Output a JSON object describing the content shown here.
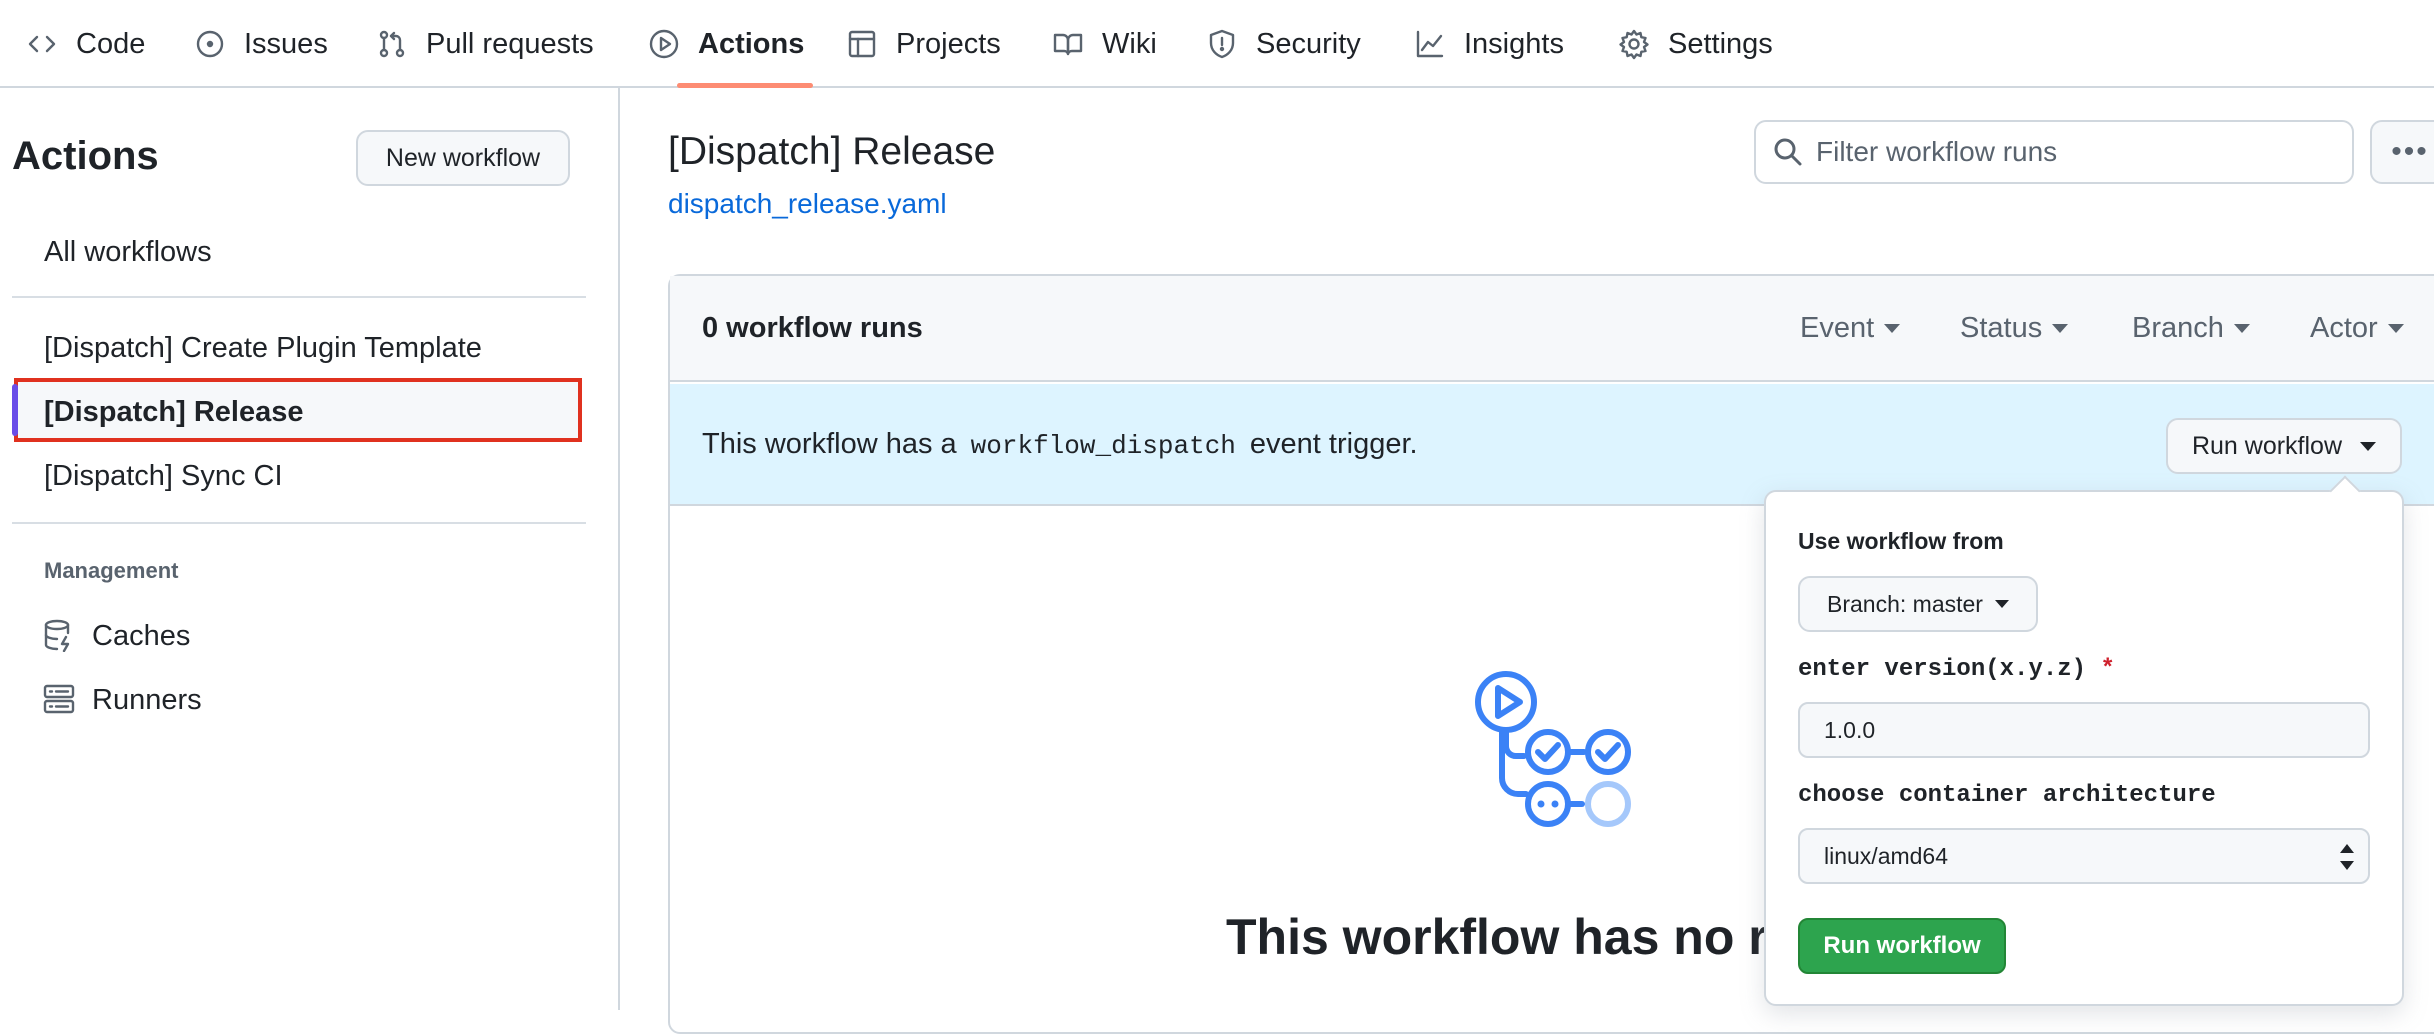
{
  "nav": {
    "code": "Code",
    "issues": "Issues",
    "pull_requests": "Pull requests",
    "actions": "Actions",
    "projects": "Projects",
    "wiki": "Wiki",
    "security": "Security",
    "insights": "Insights",
    "settings": "Settings"
  },
  "sidebar": {
    "title": "Actions",
    "new_workflow": "New workflow",
    "all_workflows": "All workflows",
    "workflows": [
      "[Dispatch] Create Plugin Template",
      "[Dispatch] Release",
      "[Dispatch] Sync CI"
    ],
    "management_heading": "Management",
    "caches": "Caches",
    "runners": "Runners"
  },
  "main": {
    "title": "[Dispatch] Release",
    "file_link": "dispatch_release.yaml",
    "search_placeholder": "Filter workflow runs",
    "runs_count": "0 workflow runs",
    "filters": [
      "Event",
      "Status",
      "Branch",
      "Actor"
    ],
    "banner_prefix": "This workflow has a",
    "banner_code": "workflow_dispatch",
    "banner_suffix": "event trigger.",
    "run_button": "Run workflow",
    "empty_title": "This workflow has no runs yet."
  },
  "popover": {
    "use_from_label": "Use workflow from",
    "branch_button": "Branch: master",
    "version_label": "enter version(x.y.z)",
    "required_mark": "*",
    "version_value": "1.0.0",
    "arch_label": "choose container architecture",
    "arch_value": "linux/amd64",
    "submit": "Run workflow"
  },
  "colors": {
    "accent_underline": "#fd8c73",
    "link": "#0969da",
    "banner_bg": "#ddf4ff",
    "run_green": "#2da44e",
    "highlight_red": "#e0311f"
  }
}
